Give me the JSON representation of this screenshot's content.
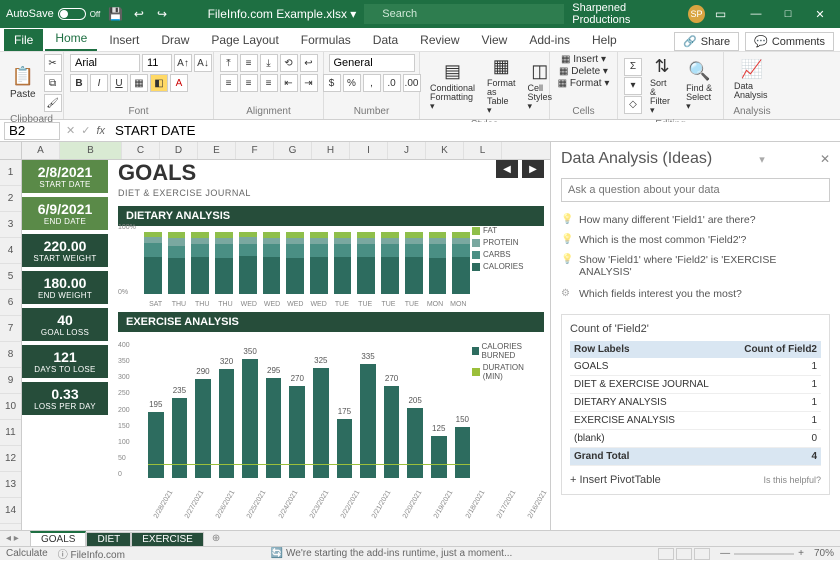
{
  "titlebar": {
    "autosave": "AutoSave",
    "autosave_state": "Off",
    "filename": "FileInfo.com Example.xlsx  ▾",
    "search_placeholder": "Search",
    "org": "Sharpened Productions",
    "avatar": "SP"
  },
  "tabs": [
    "File",
    "Home",
    "Insert",
    "Draw",
    "Page Layout",
    "Formulas",
    "Data",
    "Review",
    "View",
    "Add-ins",
    "Help"
  ],
  "active_tab": "Home",
  "share": "Share",
  "comments": "Comments",
  "ribbon": {
    "clipboard": {
      "paste": "Paste",
      "label": "Clipboard"
    },
    "font": {
      "name": "Arial",
      "size": "11",
      "label": "Font"
    },
    "alignment_label": "Alignment",
    "number": {
      "format": "General",
      "label": "Number"
    },
    "styles": {
      "cf": "Conditional Formatting ▾",
      "ft": "Format as Table ▾",
      "cs": "Cell Styles ▾",
      "label": "Styles"
    },
    "cells": {
      "ins": "Insert ▾",
      "del": "Delete ▾",
      "fmt": "Format ▾",
      "label": "Cells"
    },
    "editing": {
      "sort": "Sort & Filter ▾",
      "find": "Find & Select ▾",
      "label": "Editing"
    },
    "analysis": {
      "da": "Data Analysis",
      "label": "Analysis"
    }
  },
  "namebox": "B2",
  "formula": "START DATE",
  "col_headers": [
    "A",
    "B",
    "C",
    "D",
    "E",
    "F",
    "G",
    "H",
    "I",
    "J",
    "K",
    "L"
  ],
  "row_headers": [
    "1",
    "2",
    "3",
    "4",
    "5",
    "6",
    "7",
    "8",
    "9",
    "10",
    "11",
    "12",
    "13",
    "14"
  ],
  "side_cards": [
    {
      "v": "2/8/2021",
      "l": "START DATE"
    },
    {
      "v": "6/9/2021",
      "l": "END DATE"
    },
    {
      "v": "220.00",
      "l": "START WEIGHT"
    },
    {
      "v": "180.00",
      "l": "END WEIGHT"
    },
    {
      "v": "40",
      "l": "GOAL LOSS"
    },
    {
      "v": "121",
      "l": "DAYS TO LOSE"
    },
    {
      "v": "0.33",
      "l": "LOSS PER DAY"
    }
  ],
  "page_title": "GOALS",
  "subtitle": "DIET & EXERCISE JOURNAL",
  "panel1": "DIETARY ANALYSIS",
  "panel2": "EXERCISE ANALYSIS",
  "legendA": [
    "FAT",
    "PROTEIN",
    "CARBS",
    "CALORIES"
  ],
  "legendB": [
    "CALORIES BURNED",
    "DURATION (MIN)"
  ],
  "chart_data": [
    {
      "type": "bar",
      "stacked": true,
      "title": "DIETARY ANALYSIS",
      "categories": [
        "SAT",
        "THU",
        "THU",
        "THU",
        "WED",
        "WED",
        "WED",
        "WED",
        "TUE",
        "TUE",
        "TUE",
        "TUE",
        "MON",
        "MON"
      ],
      "ylabel": "%",
      "ylim": [
        0,
        100
      ],
      "series": [
        {
          "name": "CALORIES",
          "color": "#2d6c5f",
          "values": [
            60,
            58,
            60,
            58,
            62,
            60,
            58,
            60,
            60,
            60,
            60,
            60,
            58,
            60
          ]
        },
        {
          "name": "CARBS",
          "color": "#4a8f84",
          "values": [
            22,
            20,
            20,
            22,
            18,
            20,
            22,
            20,
            20,
            20,
            20,
            20,
            22,
            20
          ]
        },
        {
          "name": "PROTEIN",
          "color": "#7aa8a0",
          "values": [
            10,
            12,
            10,
            10,
            12,
            10,
            10,
            10,
            10,
            10,
            10,
            10,
            10,
            10
          ]
        },
        {
          "name": "FAT",
          "color": "#8fbf4a",
          "values": [
            8,
            10,
            10,
            10,
            8,
            10,
            10,
            10,
            10,
            10,
            10,
            10,
            10,
            10
          ]
        }
      ]
    },
    {
      "type": "bar",
      "title": "EXERCISE ANALYSIS",
      "categories": [
        "2/28/2021",
        "2/27/2021",
        "2/26/2021",
        "2/25/2021",
        "2/24/2021",
        "2/23/2021",
        "2/22/2021",
        "2/21/2021",
        "2/20/2021",
        "2/19/2021",
        "2/18/2021",
        "2/17/2021",
        "2/16/2021",
        "2/15/2021"
      ],
      "ylabel": "",
      "ylim": [
        0,
        400
      ],
      "series": [
        {
          "name": "CALORIES BURNED",
          "color": "#2d6c5f",
          "values": [
            195,
            235,
            290,
            320,
            350,
            295,
            270,
            325,
            175,
            335,
            270,
            205,
            125,
            150
          ]
        },
        {
          "name": "DURATION (MIN)",
          "color": "#9bbf3a",
          "values": [
            30,
            32,
            30,
            31,
            33,
            29,
            30,
            32,
            28,
            31,
            30,
            29,
            27,
            28
          ]
        }
      ]
    }
  ],
  "ideas": {
    "title": "Data Analysis (Ideas)",
    "ask_placeholder": "Ask a question about your data",
    "suggestions": [
      "How many different 'Field1' are there?",
      "Which is the most common 'Field2'?",
      "Show 'Field1' where 'Field2' is 'EXERCISE ANALYSIS'"
    ],
    "sugg_header": "Which fields interest you the most?",
    "card_title": "Count of 'Field2'",
    "tbl_headers": [
      "Row Labels",
      "Count of Field2"
    ],
    "tbl_rows": [
      [
        "GOALS",
        "1"
      ],
      [
        "DIET & EXERCISE JOURNAL",
        "1"
      ],
      [
        "DIETARY ANALYSIS",
        "1"
      ],
      [
        "EXERCISE ANALYSIS",
        "1"
      ],
      [
        "(blank)",
        "0"
      ]
    ],
    "tbl_total": [
      "Grand Total",
      "4"
    ],
    "insert_pivot": "+  Insert PivotTable",
    "helpful": "Is this helpful?"
  },
  "sheet_tabs": [
    "GOALS",
    "DIET",
    "EXERCISE"
  ],
  "status": {
    "left": "Calculate",
    "mid": "🔄 We're starting the add-ins runtime, just a moment...",
    "zoom": "70%",
    "footer": "ⓘ FileInfo.com"
  }
}
